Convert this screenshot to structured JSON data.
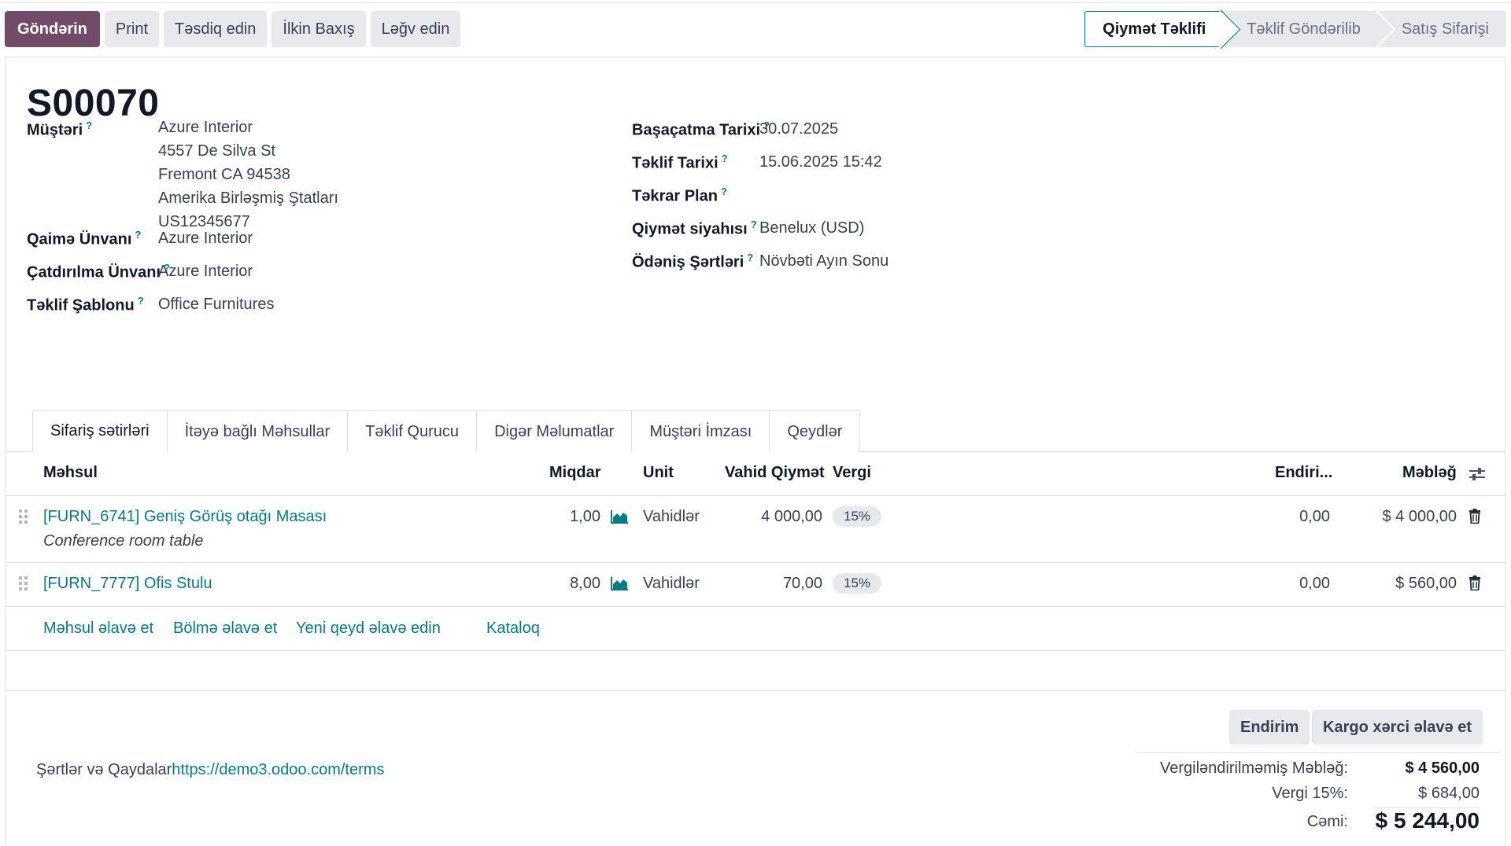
{
  "actions": {
    "send": "Göndərin",
    "print": "Print",
    "confirm": "Təsdiq edin",
    "preview": "İlkin Baxış",
    "cancel": "Ləğv edin"
  },
  "status": {
    "stages": [
      "Qiymət Təklifi",
      "Təklif Göndərilib",
      "Satış Sifarişi"
    ],
    "active": "Qiymət Təklifi"
  },
  "record": {
    "title": "S00070"
  },
  "left_fields": {
    "customer_label": "Müştəri",
    "customer_lines": [
      "Azure Interior",
      "4557 De Silva St",
      "Fremont CA 94538",
      "Amerika Birləşmiş Ştatları",
      "US12345677"
    ],
    "invoice_address_label": "Qaimə Ünvanı",
    "invoice_address": "Azure Interior",
    "delivery_address_label": "Çatdırılma Ünvanı",
    "delivery_address": "Azure Interior",
    "template_label": "Təklif Şablonu",
    "template": "Office Furnitures"
  },
  "right_fields": {
    "expiration_label": "Başaçatma Tarixi",
    "expiration": "30.07.2025",
    "quote_date_label": "Təklif Tarixi",
    "quote_date": "15.06.2025 15:42",
    "recurrence_label": "Təkrar Plan",
    "recurrence": "",
    "pricelist_label": "Qiymət siyahısı",
    "pricelist": "Benelux (USD)",
    "payment_terms_label": "Ödəniş Şərtləri",
    "payment_terms": "Növbəti Ayın Sonu"
  },
  "help_mark": "?",
  "tabs": [
    "Sifariş sətirləri",
    "İtəyə bağlı Məhsullar",
    "Təklif Qurucu",
    "Digər Məlumatlar",
    "Müştəri İmzası",
    "Qeydlər"
  ],
  "table": {
    "headers": {
      "product": "Məhsul",
      "qty": "Miqdar",
      "unit": "Unit",
      "price": "Vahid Qiymət",
      "taxes": "Vergi",
      "discount": "Endiri...",
      "amount": "Məbləğ"
    },
    "rows": [
      {
        "product": "[FURN_6741] Geniş Görüş otağı Masası",
        "description": "Conference room table",
        "qty": "1,00",
        "unit": "Vahidlər",
        "price": "4 000,00",
        "tax": "15%",
        "discount": "0,00",
        "amount": "$ 4 000,00"
      },
      {
        "product": "[FURN_7777] Ofis Stulu",
        "description": "",
        "qty": "8,00",
        "unit": "Vahidlər",
        "price": "70,00",
        "tax": "15%",
        "discount": "0,00",
        "amount": "$ 560,00"
      }
    ],
    "add_product": "Məhsul əlavə et",
    "add_section": "Bölmə əlavə et",
    "add_note": "Yeni qeyd əlavə edin",
    "catalog": "Kataloq"
  },
  "footer": {
    "terms_label": "Şərtlər və Qaydalar",
    "terms_link": "https://demo3.odoo.com/terms",
    "discount_button": "Endirim",
    "shipping_button": "Kargo xərci əlavə et",
    "untaxed_label": "Vergiləndirilməmiş Məbləğ:",
    "untaxed_value": "$ 4 560,00",
    "tax_label": "Vergi 15%:",
    "tax_value": "$ 684,00",
    "total_label": "Cəmi:",
    "total_value": "$ 5 244,00"
  },
  "colors": {
    "primary": "#714b67",
    "link": "#017e84",
    "badge_bg": "#e7e9ed"
  }
}
